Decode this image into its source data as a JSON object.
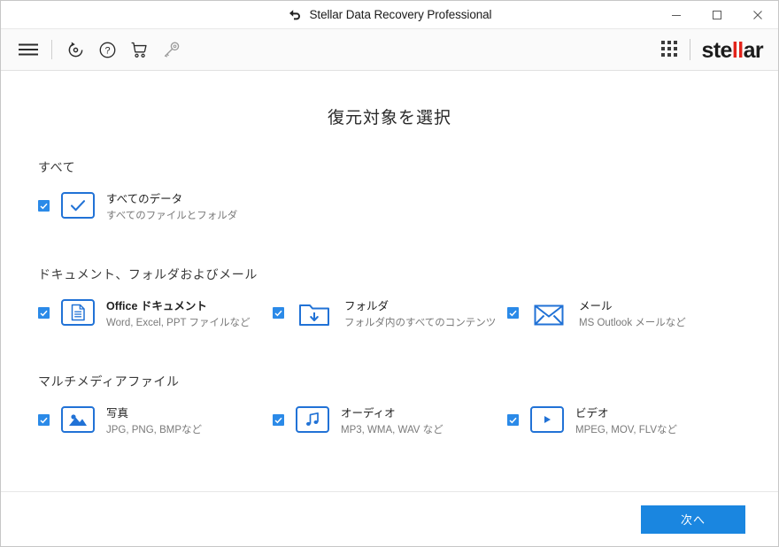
{
  "window": {
    "title": "Stellar Data Recovery Professional",
    "back_icon": "back-arrow-icon",
    "minimize_label": "─",
    "maximize_label": "□",
    "close_label": "✕"
  },
  "toolbar": {
    "icons": [
      {
        "name": "hamburger-menu-icon",
        "label": "Menu"
      },
      {
        "name": "recovery-refresh-icon",
        "label": "Recovery"
      },
      {
        "name": "help-icon",
        "label": "Help"
      },
      {
        "name": "cart-icon",
        "label": "Buy"
      },
      {
        "name": "key-icon",
        "label": "Activation"
      }
    ],
    "apps_grid_icon": "apps-grid-icon",
    "logo": {
      "prefix": "ste",
      "accent": "ll",
      "suffix": "ar",
      "accent_color": "#e2231a"
    }
  },
  "main": {
    "page_title": "復元対象を選択",
    "sections": [
      {
        "title": "すべて",
        "items": [
          {
            "icon": "check-mark-icon",
            "label": "すべてのデータ",
            "label_bold": false,
            "sub": "すべてのファイルとフォルダ",
            "checked": true
          }
        ]
      },
      {
        "title": "ドキュメント、フォルダおよびメール",
        "items": [
          {
            "icon": "document-icon",
            "label": "Office ドキュメント",
            "label_bold": true,
            "sub": "Word, Excel, PPT ファイルなど",
            "checked": true
          },
          {
            "icon": "folder-download-icon",
            "label": "フォルダ",
            "label_bold": false,
            "sub": "フォルダ内のすべてのコンテンツ",
            "checked": true
          },
          {
            "icon": "envelope-icon",
            "label": "メール",
            "label_bold": false,
            "sub": "MS Outlook メールなど",
            "checked": true
          }
        ]
      },
      {
        "title": "マルチメディアファイル",
        "items": [
          {
            "icon": "photo-icon",
            "label": "写真",
            "label_bold": false,
            "sub": "JPG, PNG, BMPなど",
            "checked": true
          },
          {
            "icon": "music-note-icon",
            "label": "オーディオ",
            "label_bold": false,
            "sub": "MP3, WMA, WAV など",
            "checked": true
          },
          {
            "icon": "play-icon",
            "label": "ビデオ",
            "label_bold": false,
            "sub": "MPEG, MOV, FLVなど",
            "checked": true
          }
        ]
      }
    ]
  },
  "footer": {
    "next_label": "次へ",
    "next_color": "#1a86e0"
  }
}
